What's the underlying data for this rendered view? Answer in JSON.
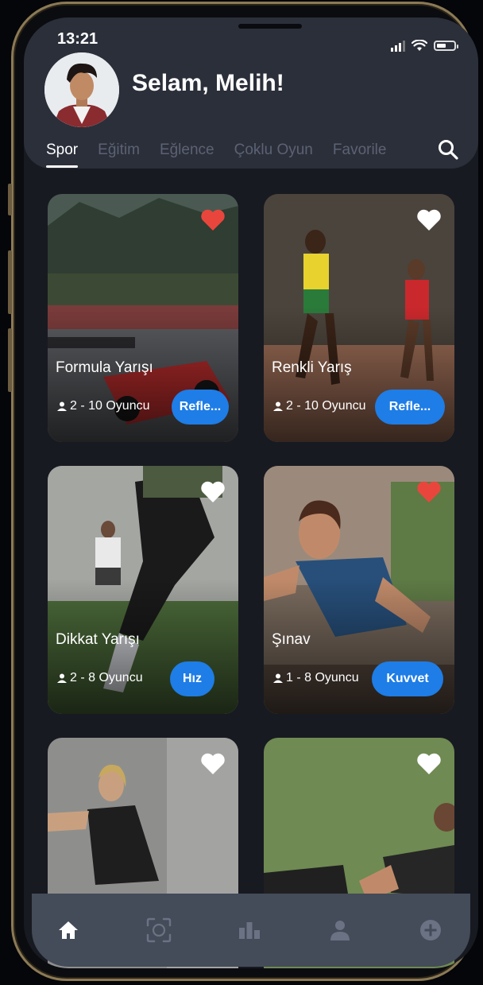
{
  "status_bar": {
    "time": "13:21"
  },
  "header": {
    "greeting": "Selam, Melih!"
  },
  "tabs": [
    {
      "label": "Spor",
      "active": true
    },
    {
      "label": "Eğitim",
      "active": false
    },
    {
      "label": "Eğlence",
      "active": false
    },
    {
      "label": "Çoklu Oyun",
      "active": false
    },
    {
      "label": "Favorile",
      "active": false
    }
  ],
  "cards": [
    {
      "title": "Formula Yarışı",
      "players": "2 - 10 Oyuncu",
      "tag": "Refle...",
      "favorite": true
    },
    {
      "title": "Renkli Yarış",
      "players": "2 - 10 Oyuncu",
      "tag": "Refle...",
      "favorite": false
    },
    {
      "title": "Dikkat Yarışı",
      "players": "2 - 8 Oyuncu",
      "tag": "Hız",
      "favorite": false
    },
    {
      "title": "Şınav",
      "players": "1 - 8 Oyuncu",
      "tag": "Kuvvet",
      "favorite": true
    },
    {
      "title": "",
      "players": "",
      "tag": "",
      "favorite": false
    },
    {
      "title": "",
      "players": "",
      "tag": "",
      "favorite": false
    }
  ],
  "nav": [
    {
      "icon": "home-icon",
      "active": true
    },
    {
      "icon": "scan-icon",
      "active": false
    },
    {
      "icon": "stats-icon",
      "active": false
    },
    {
      "icon": "profile-icon",
      "active": false
    },
    {
      "icon": "add-icon",
      "active": false
    }
  ],
  "colors": {
    "accent": "#1e7de6",
    "heart_active": "#e8463c",
    "header_bg": "#2b2f3a",
    "nav_bg": "#444b59"
  }
}
